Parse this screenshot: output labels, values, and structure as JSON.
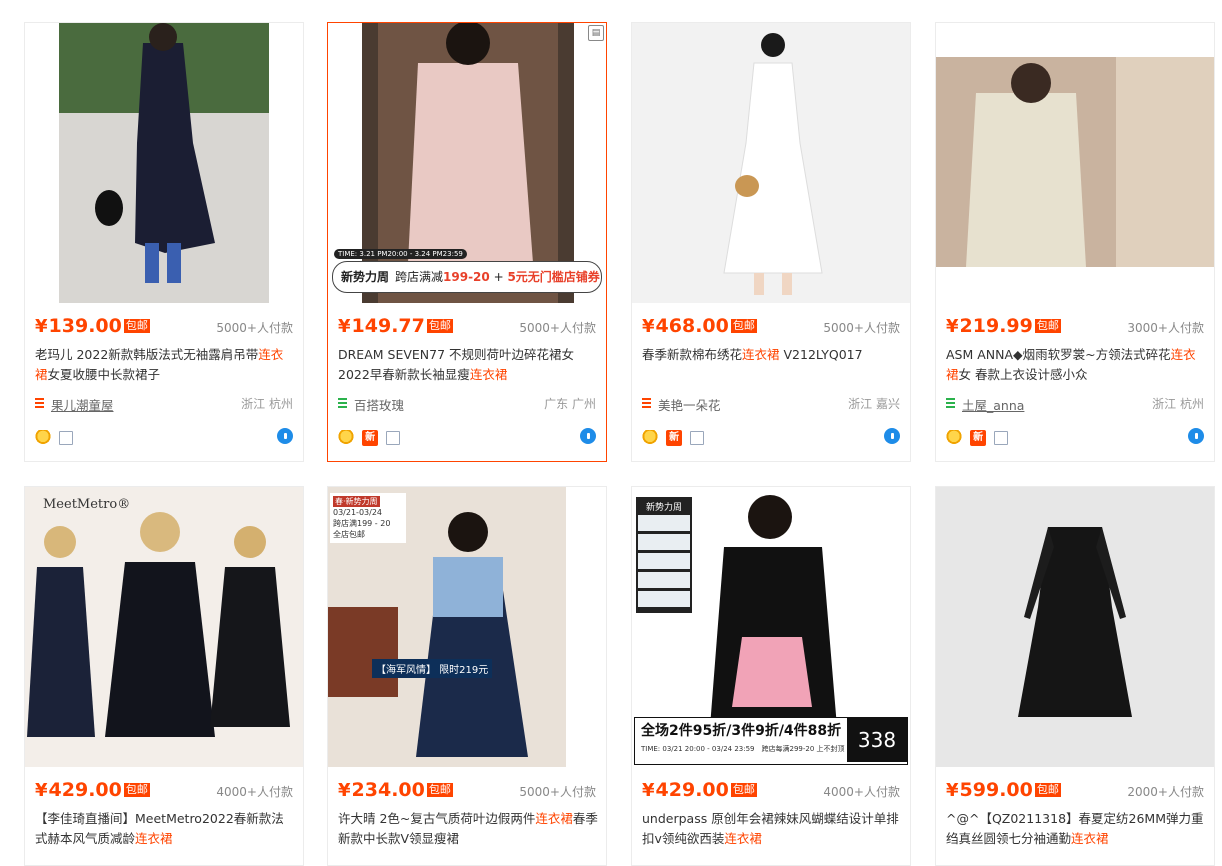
{
  "products": [
    {
      "price": "139.00",
      "baoyou": "包邮",
      "sold": "5000+人付款",
      "title_pre": "老玛儿 2022新款韩版法式无袖露肩吊带",
      "title_hl": "连衣裙",
      "title_post": "女夏收腰中长款裙子",
      "shop": "果儿潮童屋",
      "location": "浙江 杭州",
      "shop_color": "#ff4400",
      "badges": [
        "gold",
        "doc"
      ]
    },
    {
      "price": "149.77",
      "baoyou": "包邮",
      "sold": "5000+人付款",
      "title_pre": "DREAM SEVEN77 不规则荷叶边碎花裙女2022早春新款长袖显瘦",
      "title_hl": "连衣裙",
      "title_post": "",
      "shop": "百搭玫瑰",
      "location": "广东 广州",
      "shop_color": "#2bb24c",
      "badges": [
        "gold",
        "xin",
        "doc"
      ],
      "promo_name": "新势力周",
      "promo_text_pre": "跨店满减",
      "promo_text_hl": "199-20",
      "promo_text_post": " + ",
      "promo_text_hl2": "5元无门槛店铺券",
      "promo_time": "TIME: 3.21 PM20:00 - 3.24 PM23:59"
    },
    {
      "price": "468.00",
      "baoyou": "包邮",
      "sold": "5000+人付款",
      "title_pre": "春季新款棉布绣花",
      "title_hl": "连衣裙",
      "title_post": " V212LYQ017",
      "shop": "美艳一朵花",
      "location": "浙江 嘉兴",
      "shop_color": "#ff4400",
      "badges": [
        "gold",
        "xin",
        "doc"
      ]
    },
    {
      "price": "219.99",
      "baoyou": "包邮",
      "sold": "3000+人付款",
      "title_pre": "ASM ANNA◆烟雨软罗裳~方领法式碎花",
      "title_hl": "连衣裙",
      "title_post": "女 春款上衣设计感小众",
      "shop": "土屋_anna",
      "location": "浙江 杭州",
      "shop_color": "#2bb24c",
      "badges": [
        "gold",
        "xin",
        "doc"
      ]
    },
    {
      "price": "429.00",
      "baoyou": "包邮",
      "sold": "4000+人付款",
      "title_pre": "【李佳琦直播间】MeetMetro2022春新款法式赫本风气质减龄",
      "title_hl": "连衣裙",
      "title_post": "",
      "brand_logo": "MeetMetro®"
    },
    {
      "price": "234.00",
      "baoyou": "包邮",
      "sold": "5000+人付款",
      "title_pre": "许大晴 2色~复古气质荷叶边假两件",
      "title_hl": "连衣裙",
      "title_post": "春季新款中长款V领显瘦裙",
      "tag_title": "春·新势力周",
      "tag_date": "03/21-03/24",
      "tag_deal": "跨店满199 - 20",
      "tag_ship": "全店包邮",
      "price_tag": "【海军风情】 限时219元"
    },
    {
      "price": "429.00",
      "baoyou": "包邮",
      "sold": "4000+人付款",
      "title_pre": "underpass 原创年会裙辣妹风蝴蝶结设计单排扣v领纯欲西装",
      "title_hl": "连衣裙",
      "title_post": "",
      "sale_text": "全场2件95折/3件9折/4件88折",
      "sale_time": "TIME: 03/21 20:00 - 03/24 23:59",
      "sale_deal": "跨店每满299-20 上不封顶",
      "sale_price": "338",
      "side_title": "新势力周"
    },
    {
      "price": "599.00",
      "baoyou": "包邮",
      "sold": "2000+人付款",
      "title_pre": "^@^【QZ0211318】春夏定纺26MM弹力重绉真丝圆领七分袖通勤",
      "title_hl": "连衣裙",
      "title_post": ""
    }
  ]
}
